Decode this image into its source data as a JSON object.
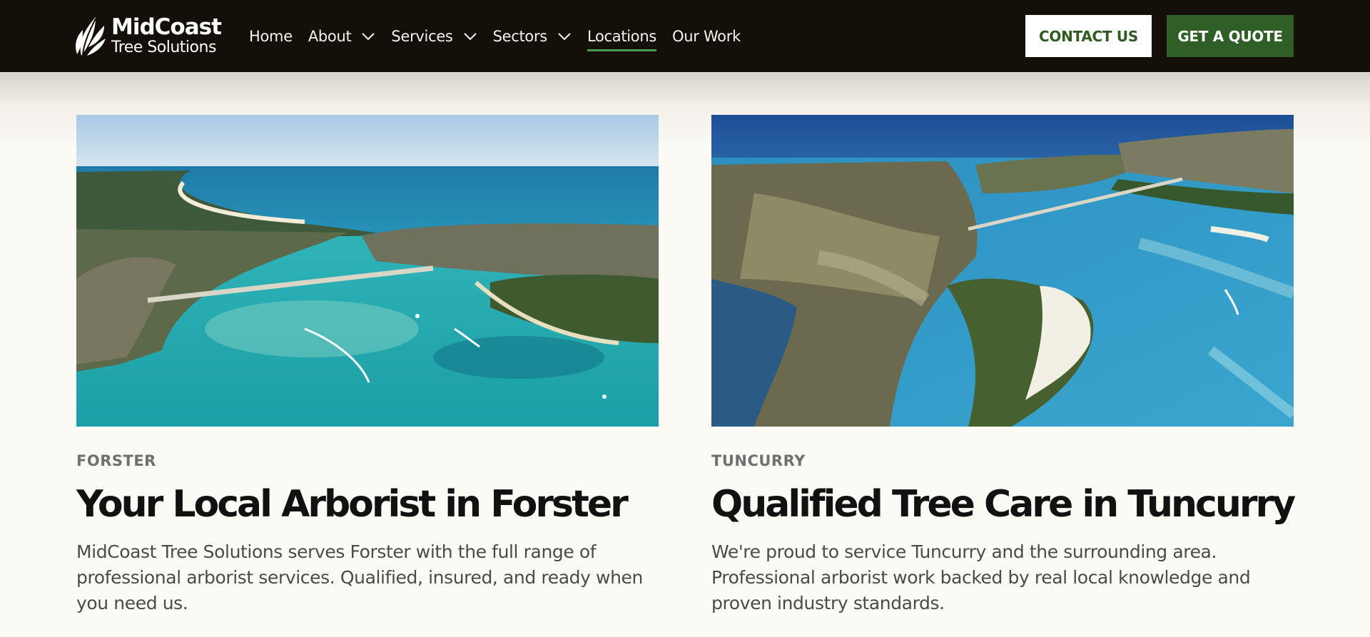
{
  "brand": {
    "name_line1": "MidCoast",
    "name_line2": "Tree Solutions",
    "logo_icon": "leaf-logo-icon"
  },
  "nav": {
    "items": [
      {
        "label": "Home",
        "has_dropdown": false
      },
      {
        "label": "About",
        "has_dropdown": true
      },
      {
        "label": "Services",
        "has_dropdown": true
      },
      {
        "label": "Sectors",
        "has_dropdown": true
      },
      {
        "label": "Locations",
        "has_dropdown": false,
        "active": true
      },
      {
        "label": "Our Work",
        "has_dropdown": false
      }
    ]
  },
  "header_actions": {
    "contact_label": "CONTACT US",
    "quote_label": "GET A QUOTE"
  },
  "locations": [
    {
      "eyebrow": "FORSTER",
      "title": "Your Local Arborist in Forster",
      "body": "MidCoast Tree Solutions serves Forster with the full range of professional arborist services. Qualified, insured, and ready when you need us.",
      "image_subject": "aerial-photo-forster-lake-bridge"
    },
    {
      "eyebrow": "TUNCURRY",
      "title": "Qualified Tree Care in Tuncurry",
      "body": "We're proud to service Tuncurry and the surrounding area. Professional arborist work backed by real local knowledge and proven industry standards.",
      "image_subject": "aerial-photo-tuncurry-inlet"
    }
  ],
  "colors": {
    "header_bg": "#140f08",
    "page_bg": "#fcfaf5",
    "brand_green": "#2f5f27",
    "active_underline": "#4a9a4d"
  }
}
